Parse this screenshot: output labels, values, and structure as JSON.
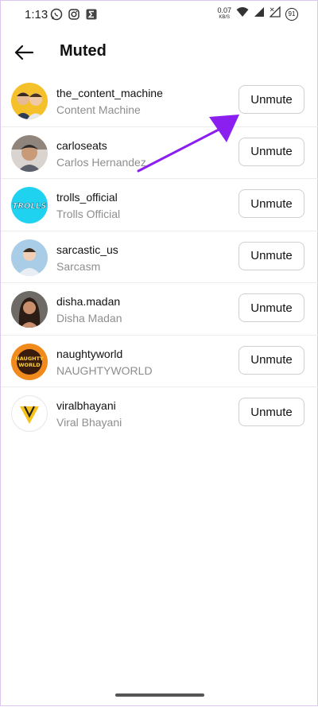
{
  "status_bar": {
    "time": "1:13",
    "net_speed": "0.07",
    "net_unit": "KB/S",
    "battery": "91",
    "left_icons": [
      "whatsapp-icon",
      "instagram-icon",
      "sigma-app-icon"
    ],
    "right_icons": [
      "wifi-icon",
      "signal-icon",
      "signal-icon"
    ]
  },
  "header": {
    "title": "Muted",
    "back_icon": "arrow-left-icon"
  },
  "muted_accounts": [
    {
      "username": "the_content_machine",
      "name": "Content Machine",
      "button": "Unmute"
    },
    {
      "username": "carloseats",
      "name": "Carlos Hernandez",
      "button": "Unmute"
    },
    {
      "username": "trolls_official",
      "name": "Trolls Official",
      "button": "Unmute"
    },
    {
      "username": "sarcastic_us",
      "name": "Sarcasm",
      "button": "Unmute"
    },
    {
      "username": "disha.madan",
      "name": "Disha Madan",
      "button": "Unmute"
    },
    {
      "username": "naughtyworld",
      "name": "NAUGHTYWORLD",
      "button": "Unmute"
    },
    {
      "username": "viralbhayani",
      "name": "Viral Bhayani",
      "button": "Unmute"
    }
  ],
  "avatars": {
    "trolls_logo_text": "TROLLS",
    "naughty_logo_text": "NAUGHTY WORLD"
  },
  "annotation": {
    "arrow_color": "#8a1ff0"
  }
}
